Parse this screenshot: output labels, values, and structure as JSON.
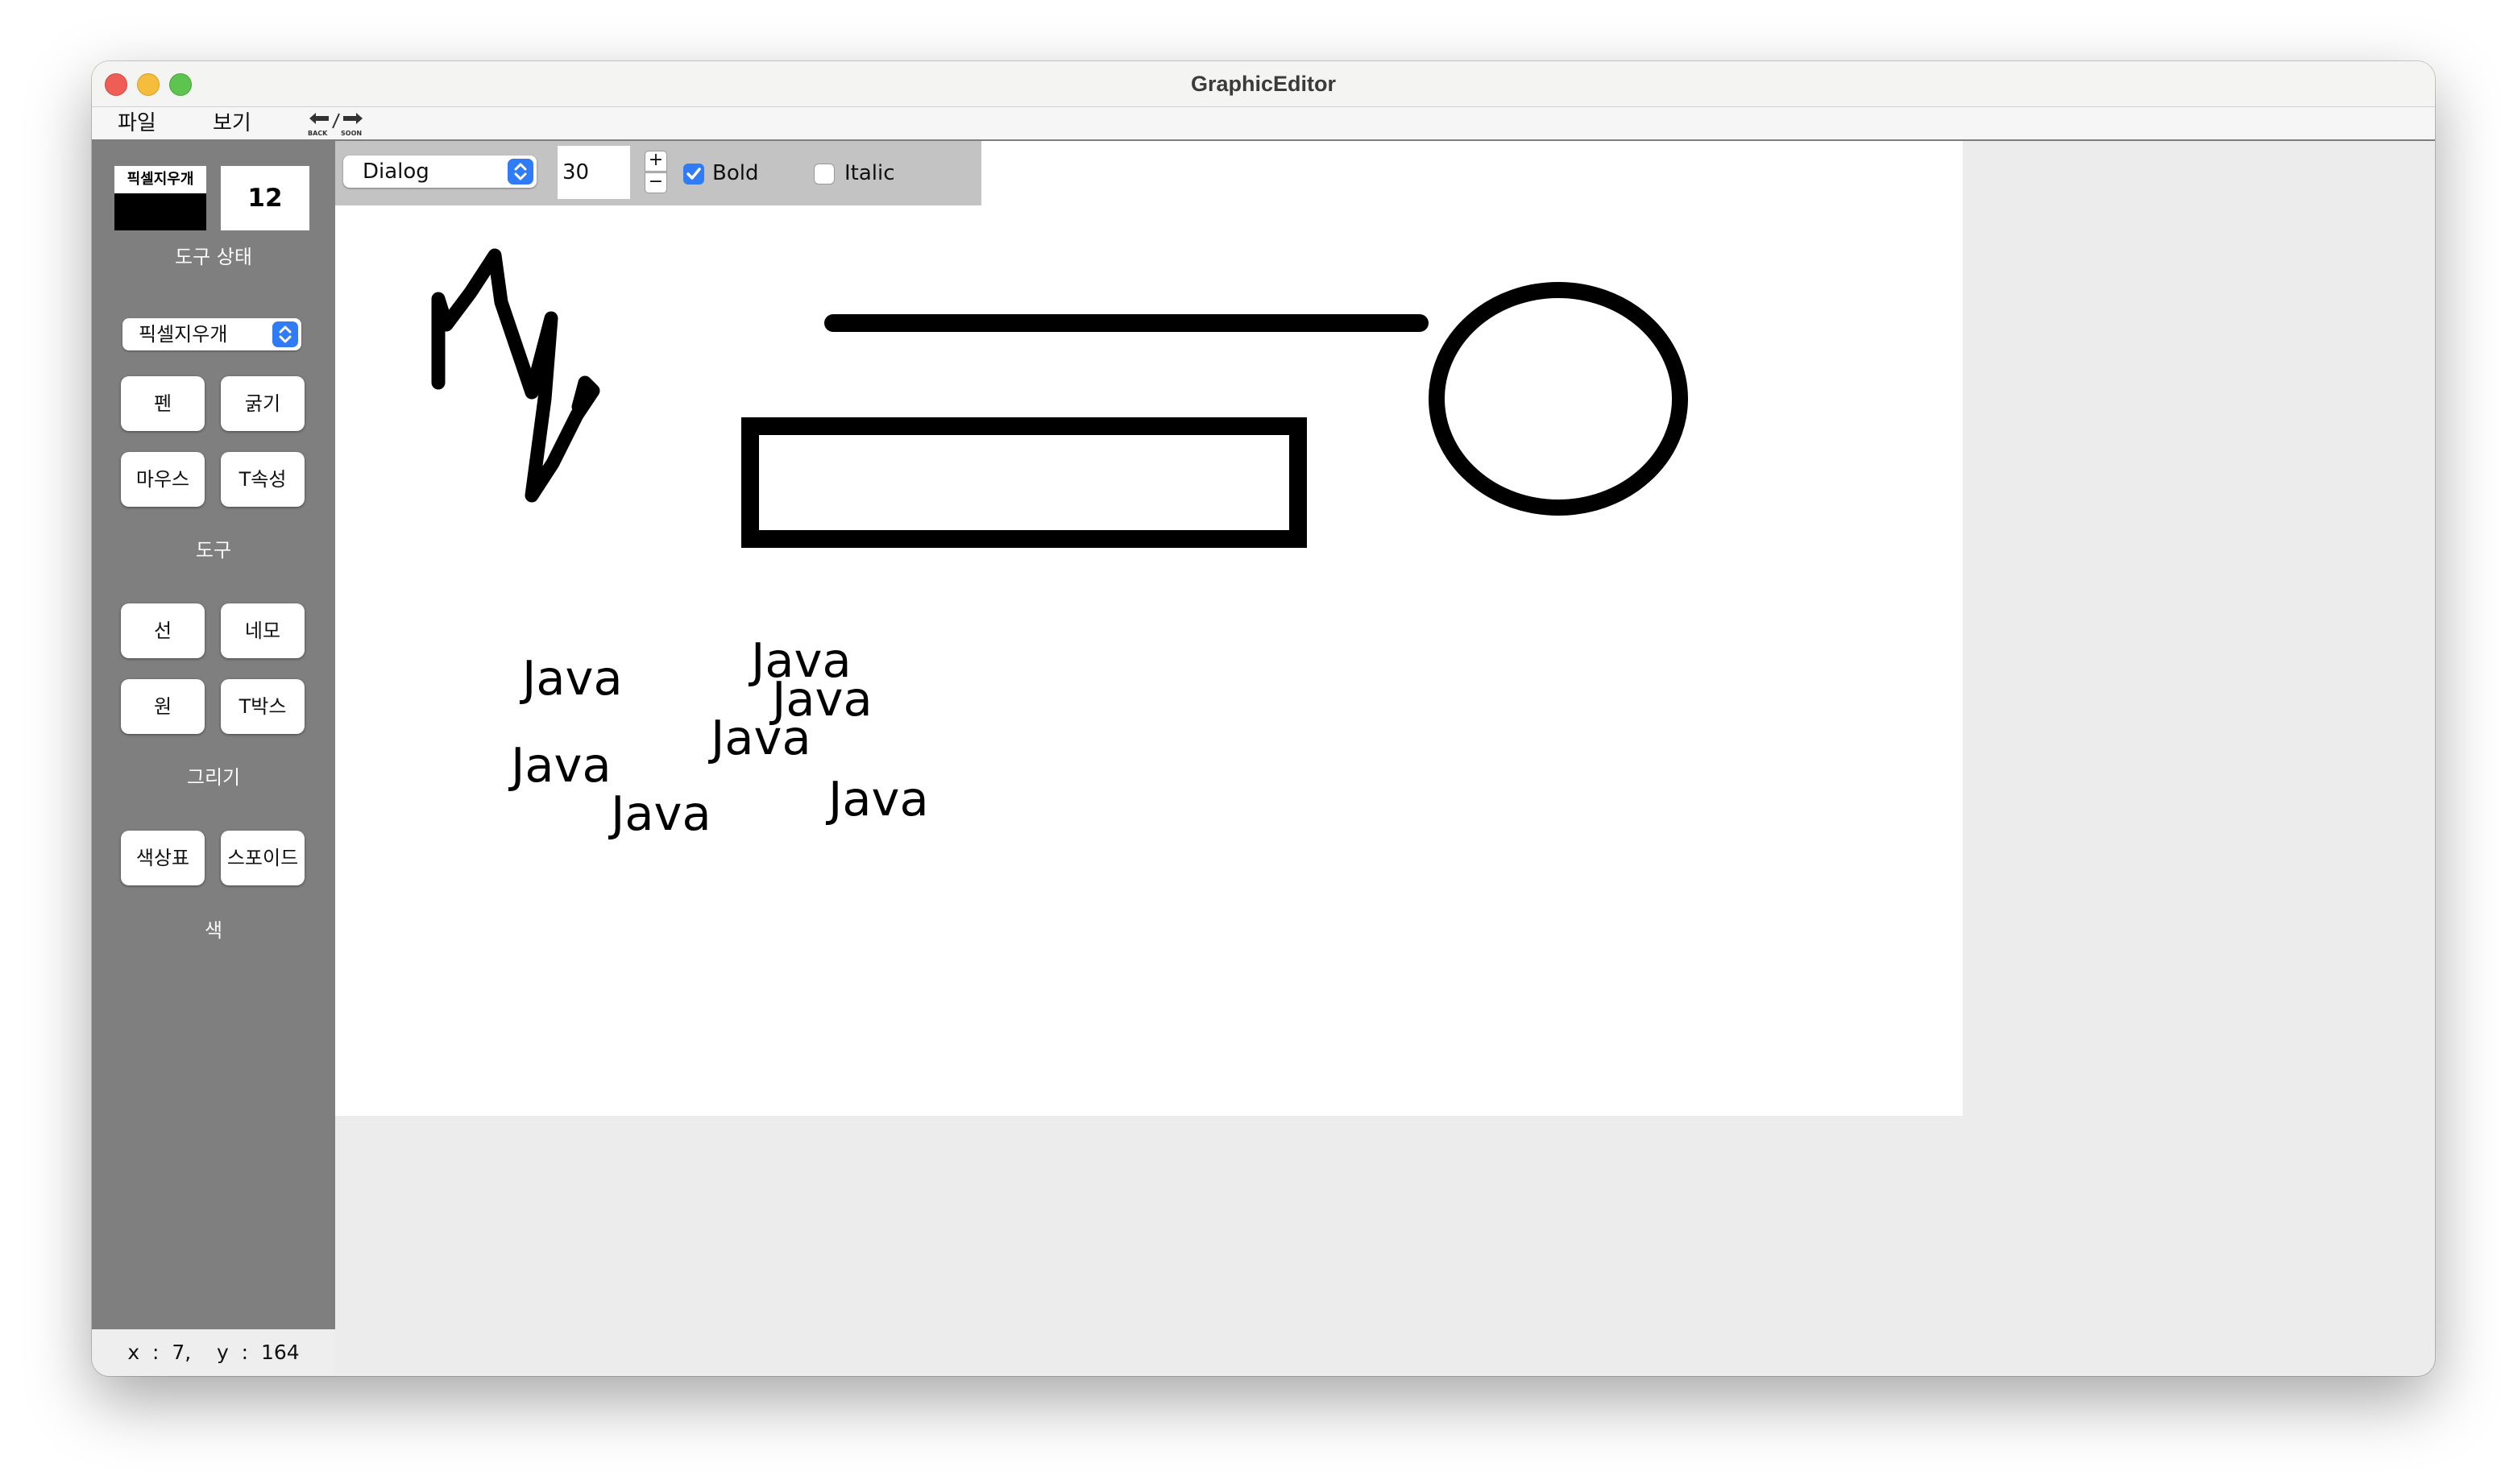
{
  "window": {
    "title": "GraphicEditor"
  },
  "menubar": {
    "file": "파일",
    "view": "보기",
    "undo_redo_icon": "back-soon-arrows-icon",
    "undo_small": "BACK",
    "redo_small": "SOON"
  },
  "sidebar": {
    "tool_state": {
      "tool_name": "픽셀지우개",
      "thickness": "12",
      "color": "#000000"
    },
    "tool_state_label": "도구 상태",
    "tool_select": {
      "selected": "픽셀지우개"
    },
    "tools": {
      "pen": "펜",
      "thickness": "굵기",
      "mouse": "마우스",
      "text_props": "T속성"
    },
    "tools_label": "도구",
    "draw": {
      "line": "선",
      "rect": "네모",
      "circle": "원",
      "textbox": "T박스"
    },
    "draw_label": "그리기",
    "color": {
      "palette": "색상표",
      "eyedropper": "스포이드"
    },
    "color_label": "색"
  },
  "text_toolbar": {
    "font": "Dialog",
    "size": "30",
    "bold_label": "Bold",
    "bold_checked": true,
    "italic_label": "Italic",
    "italic_checked": false
  },
  "canvas": {
    "texts": [
      "Java",
      "Java",
      "Java",
      "Java",
      "Java",
      "Java",
      "Java"
    ],
    "stroke_color": "#000000"
  },
  "status": {
    "coords": "x  :  7,    y  :  164"
  },
  "colors": {
    "sidebar": "#7f7f7f",
    "accent": "#2f7cf6"
  }
}
